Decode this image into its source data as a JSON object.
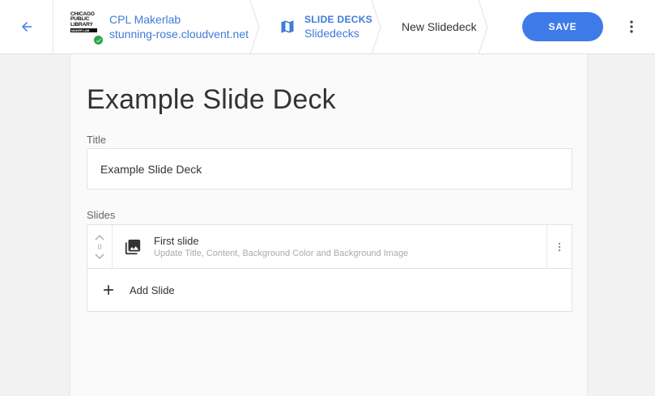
{
  "header": {
    "org_name": "CPL Makerlab",
    "org_domain": "stunning-rose.cloudvent.net",
    "logo_lines": [
      "CHICAGO",
      "PUBLIC",
      "LIBRARY"
    ],
    "logo_bar": "MAKER LAB",
    "section_category": "SLIDE DECKS",
    "section_name": "Slidedecks",
    "current_page": "New Slidedeck",
    "save_label": "SAVE"
  },
  "main": {
    "page_title": "Example Slide Deck",
    "title_label": "Title",
    "title_value": "Example Slide Deck",
    "slides_label": "Slides",
    "slides": [
      {
        "order": "0",
        "title": "First slide",
        "description": "Update Title, Content, Background Color and Background Image"
      }
    ],
    "add_slide_label": "Add Slide"
  },
  "icons": {
    "back": "arrow-left-icon",
    "decks": "map-icon",
    "more": "more-vert-icon",
    "slide": "image-icon",
    "add": "plus-icon"
  },
  "colors": {
    "accent": "#3f7be8",
    "link": "#3f7bd9",
    "check": "#2ea44f"
  }
}
